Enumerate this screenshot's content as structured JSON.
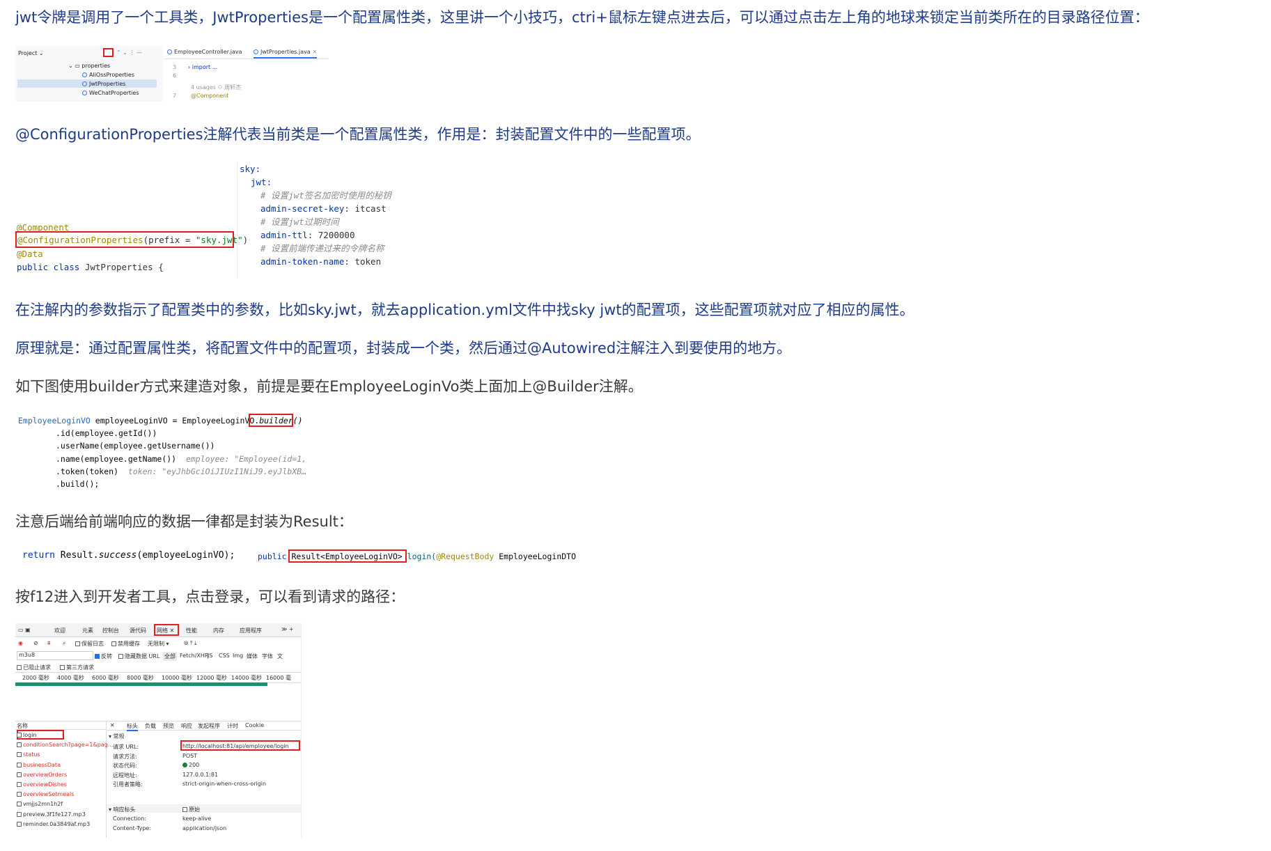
{
  "paragraphs": {
    "p1": "jwt令牌是调用了一个工具类，JwtProperties是一个配置属性类，这里讲一个小技巧，ctri+鼠标左键点进去后，可以通过点击左上角的地球来锁定当前类所在的目录路径位置：",
    "p2": "@ConfigurationProperties注解代表当前类是一个配置属性类，作用是：封装配置文件中的一些配置项。",
    "p3": "在注解内的参数指示了配置类中的参数，比如sky.jwt，就去application.yml文件中找sky jwt的配置项，这些配置项就对应了相应的属性。",
    "p4": "原理就是：通过配置属性类，将配置文件中的配置项，封装成一个类，然后通过@Autowired注解注入到要使用的地方。",
    "p5": "如下图使用builder方式来建造对象，前提是要在EmployeeLoginVo类上面加上@Builder注解。",
    "p6": "注意后端给前端响应的数据一律都是封装为Result：",
    "p7": "按f12进入到开发者工具，点击登录，可以看到请求的路径："
  },
  "ide": {
    "project_label": "Project",
    "tree": [
      "properties",
      "AliOssProperties",
      "JwtProperties",
      "WeChatProperties"
    ],
    "tabs": [
      "EmployeeController.java",
      "JwtProperties.java"
    ],
    "lines": [
      {
        "num": "3",
        "text": "import ..."
      },
      {
        "num": "6",
        "text": ""
      },
      {
        "num": "",
        "text": "4 usages  ⚇ 周轩杰"
      },
      {
        "num": "7",
        "text": "@Component"
      }
    ]
  },
  "java_class": {
    "ann1": "@Component",
    "ann2_name": "@ConfigurationProperties",
    "ann2_open": "(prefix = ",
    "ann2_str": "\"sky.jwt\"",
    "ann2_close": ")",
    "ann3": "@Data",
    "decl_kw": "public class",
    "decl_name": " JwtProperties {"
  },
  "yaml": {
    "root": "sky:",
    "jwt": "jwt:",
    "c1": "# 设置jwt签名加密时使用的秘钥",
    "k1": "admin-secret-key",
    "v1": ": itcast",
    "c2": "# 设置jwt过期时间",
    "k2": "admin-ttl",
    "v2": ": 7200000",
    "c3": "# 设置前端传递过来的令牌名称",
    "k3": "admin-token-name",
    "v3": ": token"
  },
  "builder": {
    "type": "EmployeeLoginVO",
    "assign": " employeeLoginVO = EmployeeLoginVO.",
    "call": "builder()",
    "l2": ".id(employee.getId())",
    "l3": ".userName(employee.getUsername())",
    "l4": ".name(employee.getName())",
    "h4": "employee: \"Employee(id=1,",
    "l5": ".token(token)",
    "h5": "token: \"eyJhbGciOiJIUzI1NiJ9.eyJlbXB…",
    "l6": ".build();"
  },
  "result_code": {
    "ret_kw": "return",
    "ret_body": " Result.",
    "ret_method": "success",
    "ret_tail": "(employeeLoginVO);",
    "pub_kw": "public",
    "ret_type": "Result<EmployeeLoginVO>",
    "method": "login(",
    "param_ann": "@RequestBody",
    "param": " EmployeeLoginDTO"
  },
  "devtools": {
    "tabs": [
      "欢迎",
      "元素",
      "控制台",
      "源代码",
      "网络",
      "性能",
      "内存",
      "应用程序"
    ],
    "toolbar": [
      "保留日志",
      "禁用缓存",
      "无限制"
    ],
    "filter_value": "m3u8",
    "filter_opts": [
      "反转",
      "隐藏数据 URL",
      "全部",
      "Fetch/XHR",
      "JS",
      "CSS",
      "Img",
      "媒体",
      "字体",
      "文"
    ],
    "row3": [
      "已阻止请求",
      "第三方请求"
    ],
    "timeline": [
      "2000 毫秒",
      "4000 毫秒",
      "6000 毫秒",
      "8000 毫秒",
      "10000 毫秒",
      "12000 毫秒",
      "14000 毫秒",
      "16000 毫"
    ],
    "name_header": "名称",
    "requests": [
      {
        "name": "login",
        "red": false
      },
      {
        "name": "conditionSearch?page=1&pag...",
        "red": true
      },
      {
        "name": "status",
        "red": true
      },
      {
        "name": "businessData",
        "red": true
      },
      {
        "name": "overviewOrders",
        "red": true
      },
      {
        "name": "overviewDishes",
        "red": true
      },
      {
        "name": "overviewSetmeals",
        "red": true
      },
      {
        "name": "vmjjs2mn1h2f",
        "red": false
      },
      {
        "name": "preview.3f1fe127.mp3",
        "red": false
      },
      {
        "name": "reminder.0a3849af.mp3",
        "red": false
      }
    ],
    "detail_tabs": [
      "标头",
      "负载",
      "预览",
      "响应",
      "发起程序",
      "计时",
      "Cookie"
    ],
    "general_label": "▾ 常规",
    "general": [
      {
        "k": "请求 URL:",
        "v": "http://localhost:81/api/employee/login"
      },
      {
        "k": "请求方法:",
        "v": "POST"
      },
      {
        "k": "状态代码:",
        "v": "200"
      },
      {
        "k": "远程地址:",
        "v": "127.0.0.1:81"
      },
      {
        "k": "引用者策略:",
        "v": "strict-origin-when-cross-origin"
      }
    ],
    "resp_label": "▾ 响应标头",
    "raw_label": "原始",
    "resp": [
      {
        "k": "Connection:",
        "v": "keep-alive"
      },
      {
        "k": "Content-Type:",
        "v": "application/json"
      }
    ]
  }
}
